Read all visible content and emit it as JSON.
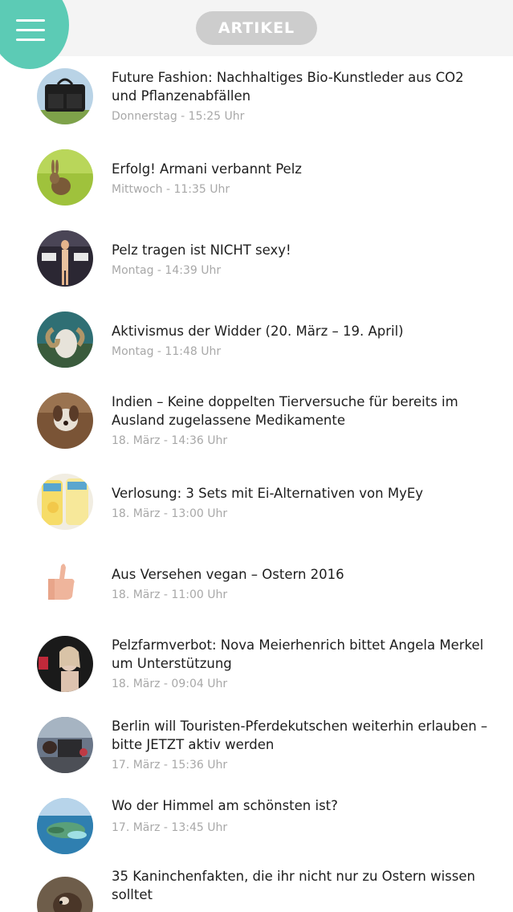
{
  "header": {
    "title": "ARTIKEL",
    "menu_icon": "hamburger-menu-icon",
    "accent_color": "#5ccbb5"
  },
  "articles": [
    {
      "title": "Future Fashion: Nachhaltiges Bio-Kunstleder aus CO2 und Pflanzenabfällen",
      "time": "Donnerstag - 15:25 Uhr",
      "thumbnail": "leather-bag-image"
    },
    {
      "title": "Erfolg! Armani verbannt Pelz",
      "time": "Mittwoch - 11:35 Uhr",
      "thumbnail": "rabbit-image"
    },
    {
      "title": "Pelz tragen ist NICHT sexy!",
      "time": "Montag - 14:39 Uhr",
      "thumbnail": "protest-image"
    },
    {
      "title": "Aktivismus der Widder (20. März – 19. April)",
      "time": "Montag - 11:48 Uhr",
      "thumbnail": "ram-image"
    },
    {
      "title": "Indien – Keine doppelten Tierversuche für bereits im Ausland zugelassene Medikamente",
      "time": "18. März - 14:36 Uhr",
      "thumbnail": "dog-painting-image"
    },
    {
      "title": "Verlosung: 3 Sets mit Ei-Alternativen von MyEy",
      "time": "18. März - 13:00 Uhr",
      "thumbnail": "myey-products-image"
    },
    {
      "title": "Aus Versehen vegan – Ostern 2016",
      "time": "18. März - 11:00 Uhr",
      "thumbnail": "thumbs-up-image"
    },
    {
      "title": "Pelzfarmverbot: Nova Meierhenrich bittet Angela Merkel um Unterstützung",
      "time": "18. März - 09:04 Uhr",
      "thumbnail": "portrait-image"
    },
    {
      "title": "Berlin will Touristen-Pferdekutschen weiterhin erlauben – bitte JETZT aktiv werden",
      "time": "17. März - 15:36 Uhr",
      "thumbnail": "horse-carriage-image"
    },
    {
      "title": "Wo der Himmel am schönsten ist?",
      "time": "17. März - 13:45 Uhr",
      "thumbnail": "island-image"
    },
    {
      "title": "35 Kaninchenfakten, die ihr nicht nur zu Ostern wissen solltet",
      "time": "",
      "thumbnail": "rabbit-closeup-image"
    }
  ]
}
